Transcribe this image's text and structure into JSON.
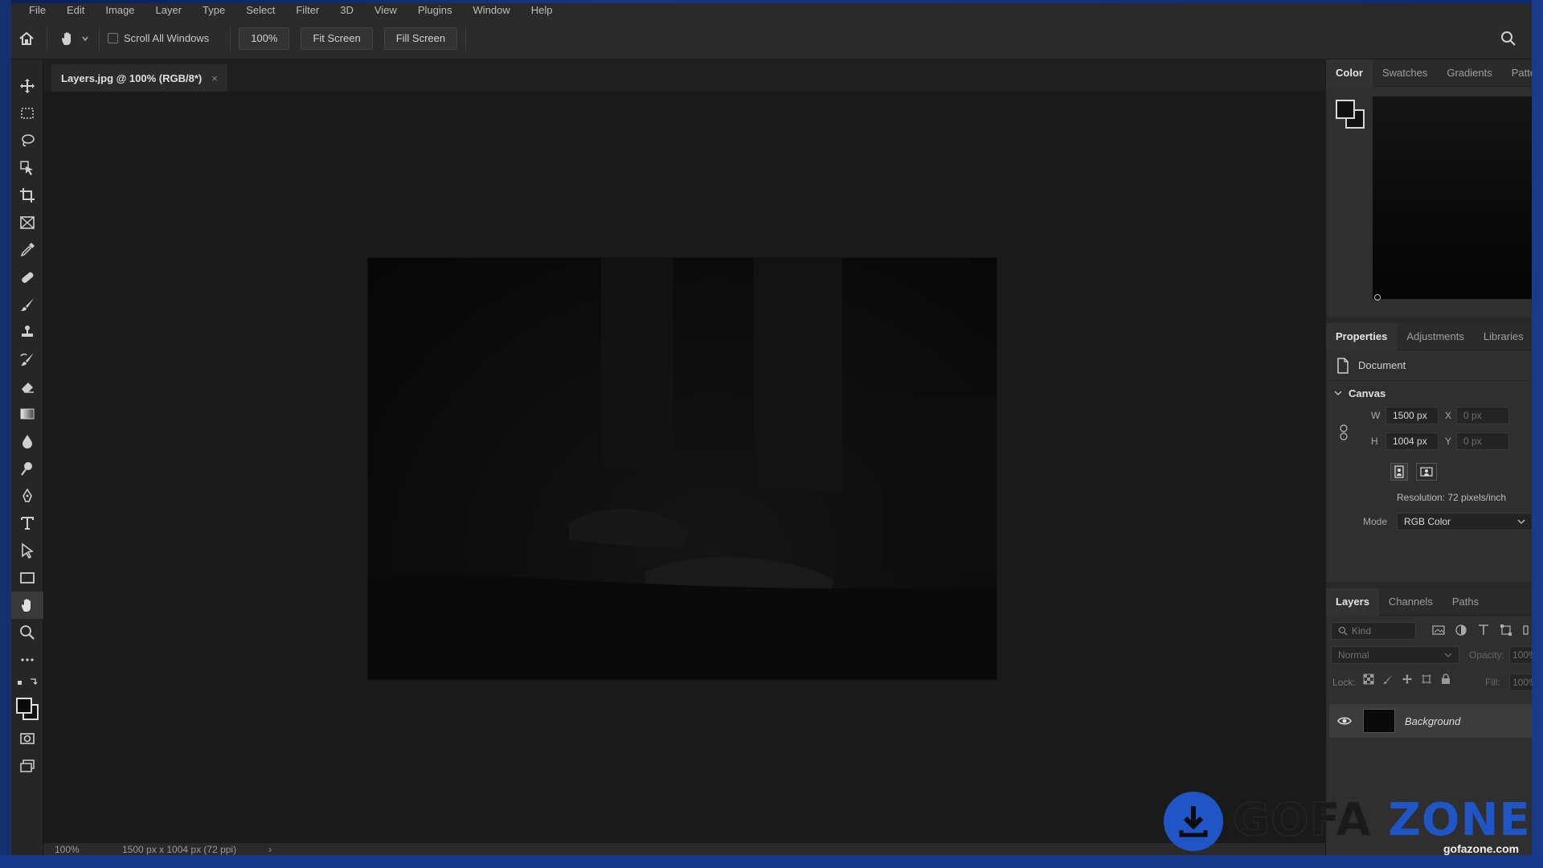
{
  "menu": [
    "File",
    "Edit",
    "Image",
    "Layer",
    "Type",
    "Select",
    "Filter",
    "3D",
    "View",
    "Plugins",
    "Window",
    "Help"
  ],
  "options": {
    "scroll_all_windows": "Scroll All Windows",
    "zoom": "100%",
    "fit_screen": "Fit Screen",
    "fill_screen": "Fill Screen"
  },
  "document": {
    "tab_title": "Layers.jpg @ 100% (RGB/8*)",
    "close": "×"
  },
  "status": {
    "zoom": "100%",
    "info": "1500 px x 1004 px (72 ppi)",
    "arrow": "›"
  },
  "color_panel": {
    "tabs": [
      "Color",
      "Swatches",
      "Gradients",
      "Patter"
    ]
  },
  "properties_panel": {
    "tabs": [
      "Properties",
      "Adjustments",
      "Libraries"
    ],
    "document_label": "Document",
    "canvas_label": "Canvas",
    "w_label": "W",
    "w_value": "1500 px",
    "h_label": "H",
    "h_value": "1004 px",
    "x_label": "X",
    "x_value": "0 px",
    "y_label": "Y",
    "y_value": "0 px",
    "resolution": "Resolution: 72 pixels/inch",
    "mode_label": "Mode",
    "mode_value": "RGB Color"
  },
  "layers_panel": {
    "tabs": [
      "Layers",
      "Channels",
      "Paths"
    ],
    "kind_placeholder": "Kind",
    "blend_mode": "Normal",
    "opacity_label": "Opacity:",
    "opacity_value": "100%",
    "lock_label": "Lock:",
    "fill_label": "Fill:",
    "fill_value": "100%",
    "layer_name": "Background"
  },
  "watermark": {
    "brand_part1": "GOFA",
    "brand_part2": "ZONE",
    "url": "gofazone.com"
  }
}
